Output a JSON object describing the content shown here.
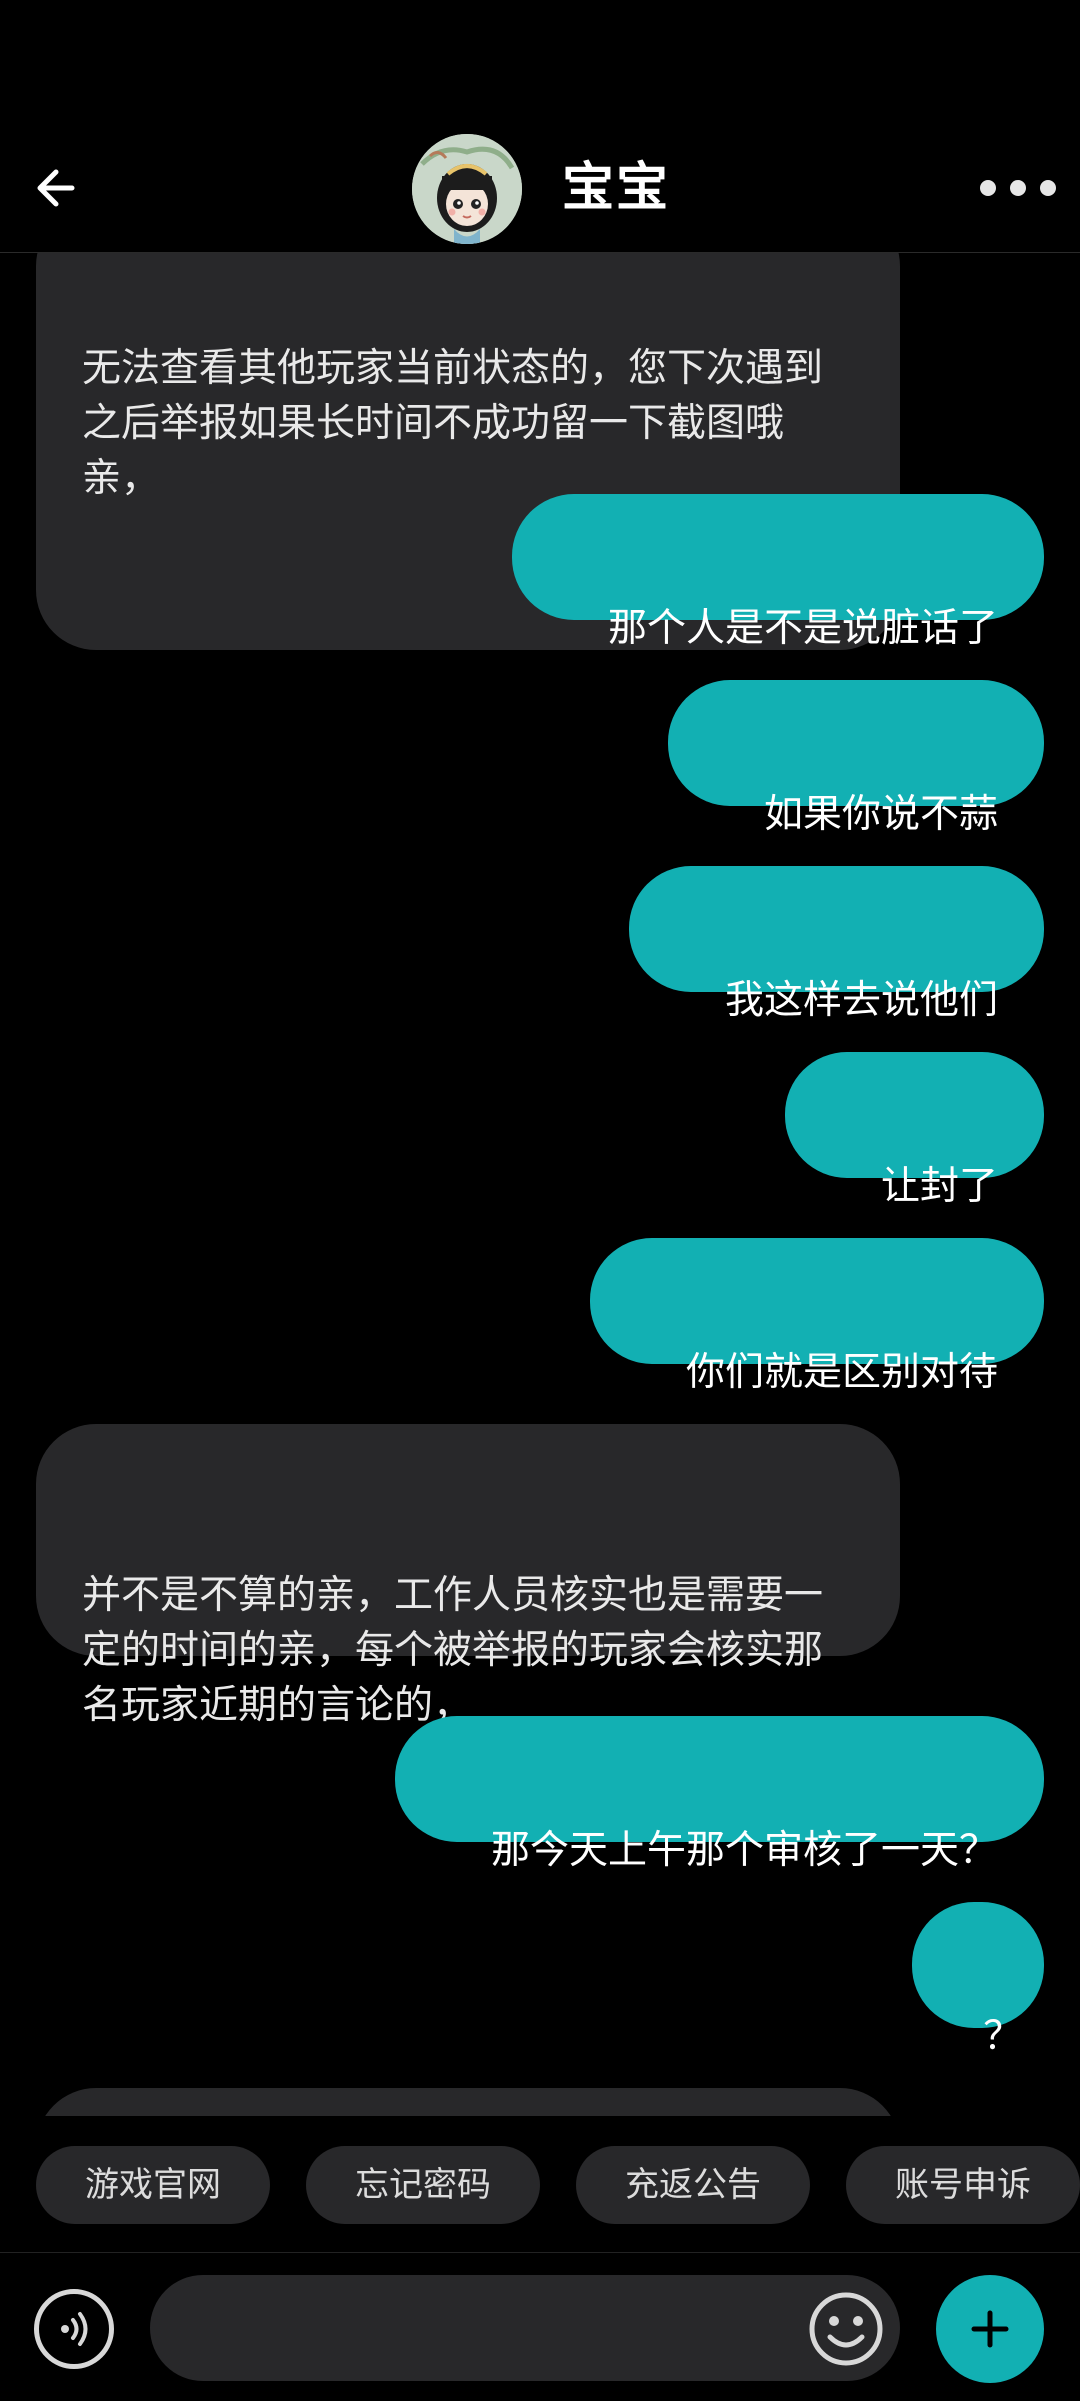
{
  "header": {
    "title": "宝宝",
    "back_icon": "arrow-left-icon",
    "more_icon": "more-horizontal-icon"
  },
  "messages": [
    {
      "side": "in",
      "text": "无法查看其他玩家当前状态的，您下次遇到之后举报如果长时间不成功留一下截图哦亲，"
    },
    {
      "side": "out",
      "text": "那个人是不是说脏话了"
    },
    {
      "side": "out",
      "text": "如果你说不蒜"
    },
    {
      "side": "out",
      "text": "我这样去说他们"
    },
    {
      "side": "out",
      "text": "让封了"
    },
    {
      "side": "out",
      "text": "你们就是区别对待"
    },
    {
      "side": "in",
      "text": "并不是不算的亲，工作人员核实也是需要一定的时间的亲，每个被举报的玩家会核实那名玩家近期的言论的，"
    },
    {
      "side": "out",
      "text": "那今天上午那个审核了一天？"
    },
    {
      "side": "out",
      "text": "？"
    }
  ],
  "quick_replies": [
    {
      "label": "游戏官网"
    },
    {
      "label": "忘记密码"
    },
    {
      "label": "充返公告"
    },
    {
      "label": "账号申诉"
    }
  ],
  "input": {
    "placeholder": "",
    "value": ""
  },
  "colors": {
    "background": "#000000",
    "accent": "#12b0b3",
    "incoming_bubble": "#28282a"
  }
}
